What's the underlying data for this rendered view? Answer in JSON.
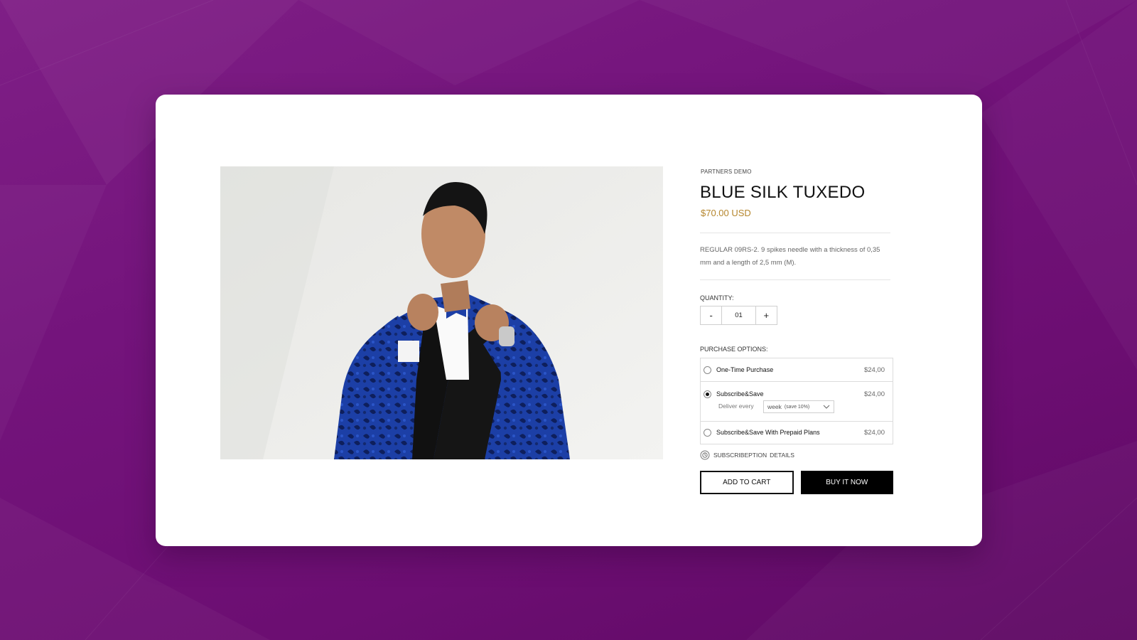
{
  "product": {
    "vendor": "PARTNERS DEMO",
    "title": "BLUE SILK TUXEDO",
    "price": "$70.00 USD",
    "description": "REGULAR 09RS-2. 9 spikes needle with a thickness of 0,35 mm and a length of 2,5 mm (M).",
    "image_icon": "product-photo"
  },
  "quantity": {
    "label": "QUANTITY:",
    "minus": "-",
    "value": "01",
    "plus": "+"
  },
  "purchase_options": {
    "label": "PURCHASE OPTIONS:",
    "selected_index": 1,
    "options": [
      {
        "name": "One-Time Purchase",
        "price": "$24,00"
      },
      {
        "name": "Subscribe&Save",
        "price": "$24,00"
      },
      {
        "name": "Subscribe&Save With Prepaid Plans",
        "price": "$24,00"
      }
    ],
    "deliver_label": "Deliver every",
    "frequency_value": "week",
    "frequency_note": "(save 10%)"
  },
  "subscription_details": {
    "word1": "SUBSCRIBEPTION",
    "word2": "DETAILS"
  },
  "actions": {
    "add_to_cart": "ADD TO CART",
    "buy_now": "BUY IT NOW"
  },
  "colors": {
    "background": "#74147c",
    "price": "#b5862d",
    "primary_button": "#000000"
  }
}
